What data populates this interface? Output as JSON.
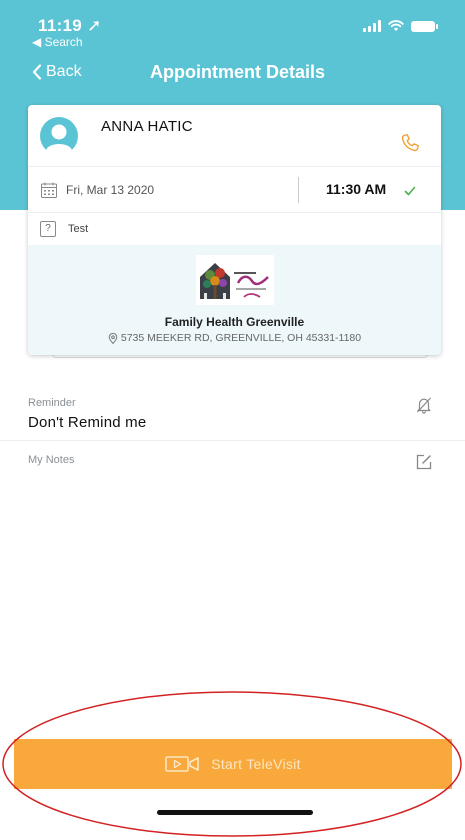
{
  "status_bar": {
    "time": "11:19 ➚",
    "back_app": "◀ Search"
  },
  "nav": {
    "back_label": "Back",
    "title": "Appointment Details"
  },
  "appointment": {
    "patient_name": "ANNA HATIC",
    "date": "Fri, Mar 13  2020",
    "time": "11:30 AM",
    "reason_icon": "?",
    "reason": "Test"
  },
  "provider": {
    "name": "Family Health Greenville",
    "address": "5735 MEEKER RD, GREENVILLE, OH 45331-1180"
  },
  "settings": {
    "reminder_label": "Reminder",
    "reminder_value": "Don't Remind me",
    "notes_label": "My Notes"
  },
  "televisit": {
    "label": "Start TeleVisit"
  },
  "colors": {
    "header": "#5bc4d4",
    "accent_orange": "#f9a93b",
    "phone": "#f0a030",
    "check": "#4caf50",
    "annotation_red": "#d32222"
  },
  "icons": [
    "location-arrow-icon",
    "signal-icon",
    "wifi-icon",
    "battery-icon",
    "chevron-left-icon",
    "avatar-icon",
    "phone-icon",
    "calendar-icon",
    "check-icon",
    "question-icon",
    "provider-logo",
    "location-pin-icon",
    "bell-off-icon",
    "note-edit-icon",
    "video-camera-icon"
  ]
}
